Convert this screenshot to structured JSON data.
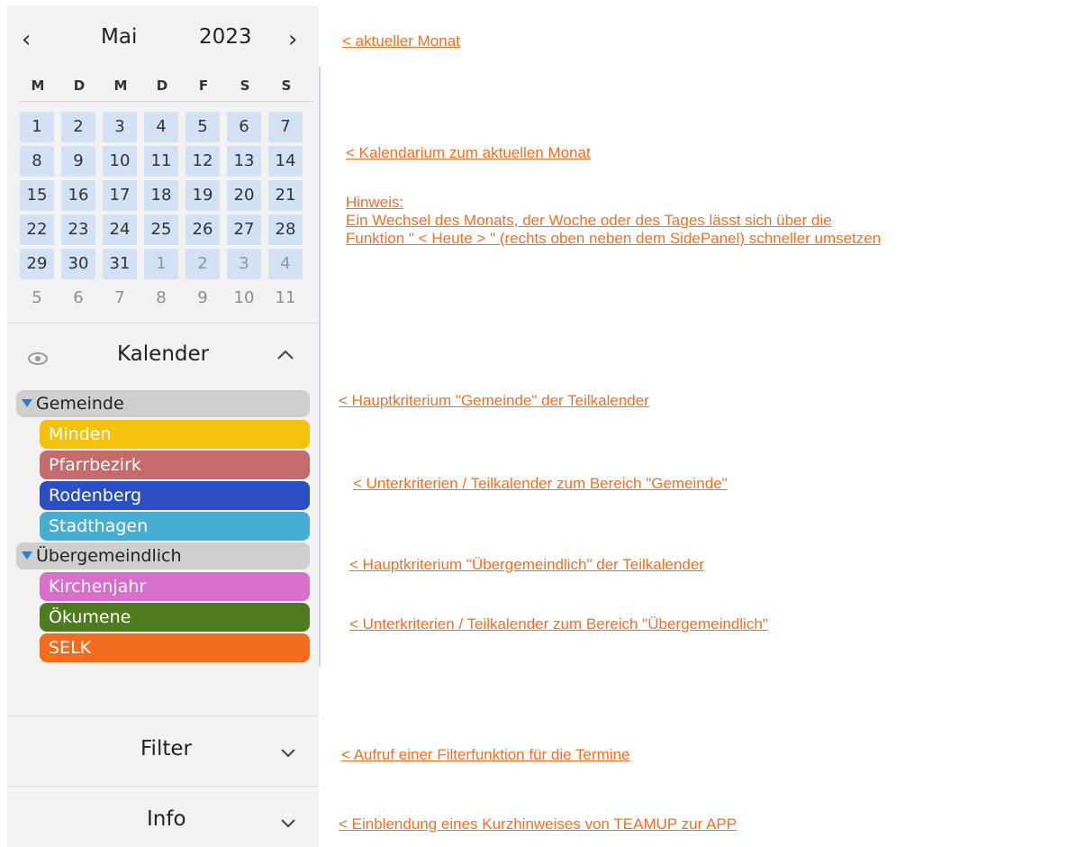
{
  "calendar": {
    "month": "Mai",
    "year": "2023",
    "prev_icon": "chevron-left-icon",
    "next_icon": "chevron-right-icon",
    "weekdays": [
      "M",
      "D",
      "M",
      "D",
      "F",
      "S",
      "S"
    ],
    "weeks": [
      [
        "1",
        "2",
        "3",
        "4",
        "5",
        "6",
        "7"
      ],
      [
        "8",
        "9",
        "10",
        "11",
        "12",
        "13",
        "14"
      ],
      [
        "15",
        "16",
        "17",
        "18",
        "19",
        "20",
        "21"
      ],
      [
        "22",
        "23",
        "24",
        "25",
        "26",
        "27",
        "28"
      ],
      [
        "29",
        "30",
        "31",
        "1",
        "2",
        "3",
        "4"
      ],
      [
        "5",
        "6",
        "7",
        "8",
        "9",
        "10",
        "11"
      ]
    ]
  },
  "calendars_panel": {
    "title": "Kalender",
    "visibility_icon": "eye-icon",
    "collapse_icon": "chevron-up-icon",
    "groups": [
      {
        "label": "Gemeinde",
        "items": [
          {
            "label": "Minden",
            "color": "#f4c20d"
          },
          {
            "label": "Pfarrbezirk",
            "color": "#c56b6b"
          },
          {
            "label": "Rodenberg",
            "color": "#2b4fc2"
          },
          {
            "label": "Stadthagen",
            "color": "#47aed2"
          }
        ]
      },
      {
        "label": "Übergemeindlich",
        "items": [
          {
            "label": "Kirchenjahr",
            "color": "#d86fcb"
          },
          {
            "label": "Ökumene",
            "color": "#4e7b1f"
          },
          {
            "label": "SELK",
            "color": "#f36c1e"
          }
        ]
      }
    ]
  },
  "filter_panel": {
    "title": "Filter",
    "icon": "chevron-down-icon"
  },
  "info_panel": {
    "title": "Info",
    "icon": "chevron-down-icon"
  },
  "annotations": {
    "current_month": "<  aktueller Monat",
    "calendarium": "< Kalendarium zum aktuellen Monat",
    "hint_title": "Hinweis:",
    "hint_line1": "Ein Wechsel des Monats, der Woche oder des Tages lässt sich über die",
    "hint_line2": "Funktion \" < Heute > \" (rechts oben neben dem SidePanel) schneller umsetzen",
    "main_gemeinde": "< Hauptkriterium \"Gemeinde\" der Teilkalender",
    "sub_gemeinde": "< Unterkriterien / Teilkalender zum Bereich \"Gemeinde\"",
    "main_uebergemeindlich": "< Hauptkriterium \"Übergemeindlich\" der Teilkalender",
    "sub_uebergemeindlich": "< Unterkriterien / Teilkalender zum Bereich \"Übergemeindlich\"",
    "filter": "< Aufruf einer Filterfunktion für die Termine",
    "info": "< Einblendung eines Kurzhinweises von TEAMUP zur APP"
  },
  "colors": {
    "accent": "#f26f22",
    "day_bg": "#d3e1f5",
    "group_bg": "#cfcfcf",
    "triangle": "#2a7fd4"
  }
}
